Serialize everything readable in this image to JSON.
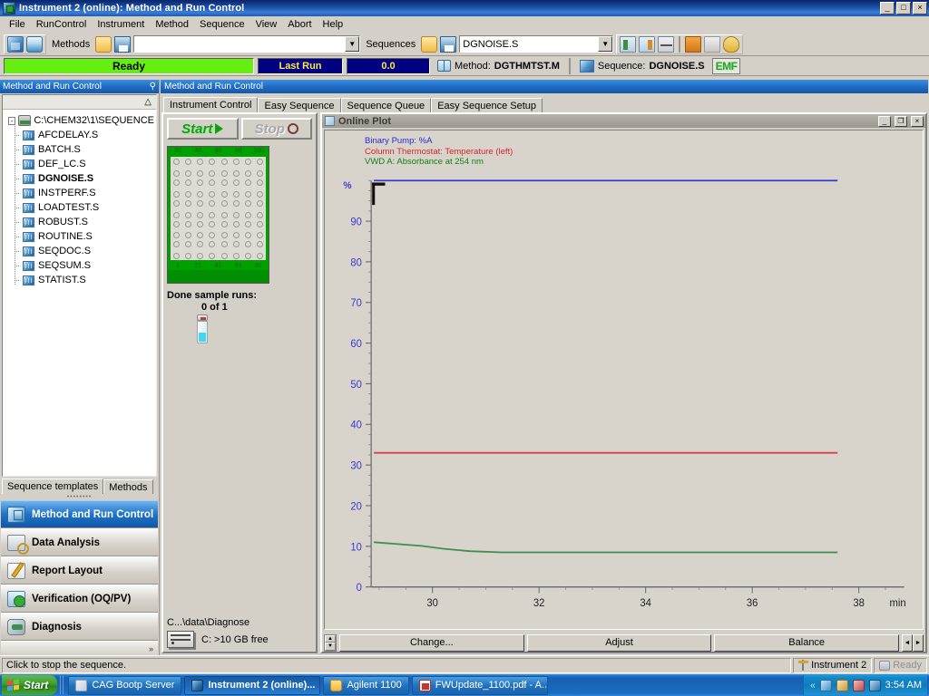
{
  "window": {
    "title": "Instrument 2 (online): Method and Run Control",
    "icon": "instrument-icon",
    "minimize": "_",
    "maximize": "□",
    "close": "×"
  },
  "menu": {
    "items": [
      "File",
      "RunControl",
      "Instrument",
      "Method",
      "Sequence",
      "View",
      "Abort",
      "Help"
    ]
  },
  "toolbar": {
    "methods_label": "Methods",
    "method_value": "",
    "sequences_label": "Sequences",
    "sequence_value": "DGNOISE.S",
    "dropdown_glyph": "▼"
  },
  "status_strip": {
    "ready": "Ready",
    "last_run_label": "Last Run",
    "last_run_time": "0.0",
    "method_label": "Method:",
    "method_name": "DGTHMTST.M",
    "sequence_label": "Sequence:",
    "sequence_name": "DGNOISE.S",
    "emf": "EMF",
    "ready_color": "#66ee11",
    "blue_color": "#000080"
  },
  "sidebar": {
    "header": "Method and Run Control",
    "pin": "⚲",
    "sort_glyph": "△",
    "tree": {
      "root": "C:\\CHEM32\\1\\SEQUENCE",
      "expander": "-",
      "items": [
        {
          "label": "AFCDELAY.S",
          "bold": false
        },
        {
          "label": "BATCH.S",
          "bold": false
        },
        {
          "label": "DEF_LC.S",
          "bold": false
        },
        {
          "label": "DGNOISE.S",
          "bold": true
        },
        {
          "label": "INSTPERF.S",
          "bold": false
        },
        {
          "label": "LOADTEST.S",
          "bold": false
        },
        {
          "label": "ROBUST.S",
          "bold": false
        },
        {
          "label": "ROUTINE.S",
          "bold": false
        },
        {
          "label": "SEQDOC.S",
          "bold": false
        },
        {
          "label": "SEQSUM.S",
          "bold": false
        },
        {
          "label": "STATIST.S",
          "bold": false
        }
      ]
    },
    "tabs": [
      {
        "label": "Sequence templates",
        "active": true
      },
      {
        "label": "Methods",
        "active": false
      }
    ],
    "nav": [
      {
        "label": "Method and Run Control",
        "icon": "method-run-control-icon",
        "active": true
      },
      {
        "label": "Data Analysis",
        "icon": "data-analysis-icon",
        "active": false
      },
      {
        "label": "Report Layout",
        "icon": "report-layout-icon",
        "active": false
      },
      {
        "label": "Verification (OQ/PV)",
        "icon": "verification-icon",
        "active": false
      },
      {
        "label": "Diagnosis",
        "icon": "diagnosis-icon",
        "active": false
      }
    ],
    "more_glyph": "»"
  },
  "main": {
    "header": "Method and Run Control",
    "tabs": [
      {
        "label": "Instrument Control",
        "active": true
      },
      {
        "label": "Easy Sequence",
        "active": false
      },
      {
        "label": "Sequence Queue",
        "active": false
      },
      {
        "label": "Easy Sequence Setup",
        "active": false
      }
    ]
  },
  "instrument_panel": {
    "start_label": "Start",
    "stop_label": "Stop",
    "tray_top_labels": [
      "20",
      "40",
      "60",
      "80",
      "100"
    ],
    "tray_bottom_labels": [
      "1",
      "21",
      "41",
      "61",
      "81"
    ],
    "tray_rows": 10,
    "tray_cols": 8,
    "done_label": "Done sample runs:",
    "done_count": "0 of 1",
    "data_path": "C...\\data\\Diagnose",
    "disk_space": "C: >10 GB free"
  },
  "online_plot": {
    "title": "Online Plot",
    "minimize": "_",
    "restore": "❐",
    "close": "×",
    "buttons": {
      "change": "Change...",
      "adjust": "Adjust",
      "balance": "Balance",
      "left_arrow": "◄",
      "right_arrow": "►",
      "spin_up": "▲",
      "spin_down": "▼"
    }
  },
  "chart_data": {
    "type": "line",
    "title": "Online Plot",
    "xlabel": "min",
    "ylabel": "%",
    "xlim": [
      28.85,
      38.85
    ],
    "ylim": [
      0,
      100
    ],
    "grid": false,
    "legend_position": "top-left",
    "xticks": [
      30,
      32,
      34,
      36,
      38
    ],
    "yticks": [
      0,
      10,
      20,
      30,
      40,
      50,
      60,
      70,
      80,
      90
    ],
    "series": [
      {
        "name": "Binary Pump: %A",
        "color": "#3a3ad0",
        "x": [
          28.9,
          31.0,
          33.0,
          35.0,
          37.0,
          37.6
        ],
        "values": [
          100,
          100,
          100,
          100,
          100,
          100
        ]
      },
      {
        "name": "Column Thermostat: Temperature (left)",
        "color": "#d8404a",
        "x": [
          28.9,
          31.0,
          33.0,
          35.0,
          37.0,
          37.6
        ],
        "values": [
          33,
          33,
          33,
          33,
          33,
          33
        ]
      },
      {
        "name": "VWD A: Absorbance at 254 nm",
        "color": "#3f8f50",
        "x": [
          28.9,
          29.3,
          29.8,
          30.2,
          30.7,
          31.3,
          32.0,
          33.0,
          34.0,
          35.0,
          36.0,
          37.0,
          37.6
        ],
        "values": [
          11.0,
          10.6,
          10.1,
          9.4,
          8.8,
          8.5,
          8.5,
          8.5,
          8.5,
          8.5,
          8.5,
          8.5,
          8.5
        ]
      }
    ]
  },
  "statusbar": {
    "message": "Click to stop the sequence.",
    "instrument": "Instrument 2",
    "state": "Ready"
  },
  "taskbar": {
    "start": "Start",
    "items": [
      {
        "label": "CAG Bootp Server",
        "icon": "cag-bootp-icon",
        "active": false
      },
      {
        "label": "Instrument 2 (online)...",
        "icon": "instrument-icon",
        "active": true
      },
      {
        "label": "Agilent 1100",
        "icon": "folder-icon",
        "active": false
      },
      {
        "label": "FWUpdate_1100.pdf - A...",
        "icon": "pdf-icon",
        "active": false
      }
    ],
    "tray_chevron": "«",
    "tray_icons": [
      "network-icon",
      "media-icon",
      "update-icon",
      "display-icon"
    ],
    "clock": "3:54 AM"
  }
}
